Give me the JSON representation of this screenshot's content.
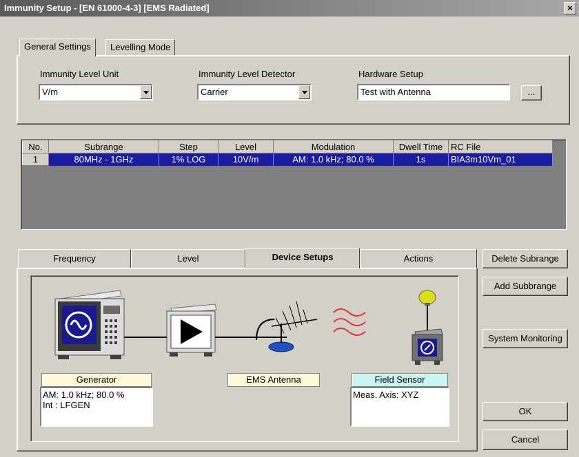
{
  "window": {
    "title": "Immunity Setup - [EN 61000-4-3] [EMS Radiated]",
    "close": "×"
  },
  "top_tabs": [
    "General Settings",
    "Levelling Mode"
  ],
  "general": {
    "unit_label": "Immunity Level Unit",
    "unit_value": "V/m",
    "detector_label": "Immunity Level Detector",
    "detector_value": "Carrier",
    "hardware_label": "Hardware Setup",
    "hardware_value": "Test with Antenna",
    "browse_label": "..."
  },
  "table": {
    "columns": [
      "No.",
      "Subrange",
      "Step",
      "Level",
      "Modulation",
      "Dwell Time",
      "RC File"
    ],
    "rows": [
      [
        "1",
        "80MHz - 1GHz",
        "1% LOG",
        "10V/m",
        "AM: 1.0 kHz; 80.0 %",
        "1s",
        "BIA3m10Vm_01"
      ]
    ]
  },
  "bottom_tabs": [
    "Frequency",
    "Level",
    "Device Setups",
    "Actions"
  ],
  "devices": {
    "generator": {
      "label": "Generator",
      "lines": [
        "AM: 1.0 kHz; 80.0 %",
        "Int : LFGEN"
      ]
    },
    "antenna": {
      "label": "EMS Antenna"
    },
    "sensor": {
      "label": "Field Sensor",
      "lines": [
        "Meas. Axis: XYZ"
      ]
    }
  },
  "buttons": {
    "delete": "Delete Subrange",
    "add": "Add Subbrange",
    "monitor": "System Monitoring",
    "ok": "OK",
    "cancel": "Cancel"
  },
  "colors": {
    "selection": "#1c1ca0",
    "generator_label_bg": "#fff8d8",
    "antenna_label_bg": "#fff8d8",
    "sensor_label_bg": "#c8f4f4"
  }
}
